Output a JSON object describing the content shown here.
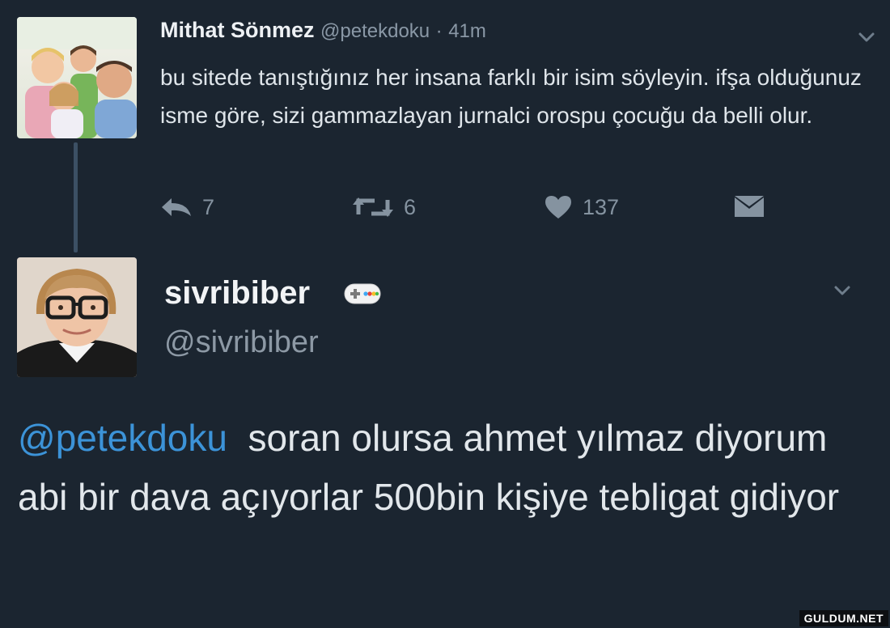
{
  "tweet1": {
    "name": "Mithat Sönmez",
    "handle": "@petekdoku",
    "dot": "·",
    "time": "41m",
    "text": "bu sitede tanıştığınız her insana farklı bir isim söyleyin. ifşa olduğunuz isme göre, sizi gammazlayan jurnalci orospu çocuğu da belli olur.",
    "actions": {
      "reply_icon": "reply-icon",
      "reply_count": "7",
      "retweet_icon": "retweet-icon",
      "retweet_count": "6",
      "like_icon": "heart-icon",
      "like_count": "137",
      "dm_icon": "envelope-icon"
    }
  },
  "tweet2": {
    "name": "sivribiber",
    "badge_icon": "gamepad-icon",
    "handle": "@sivribiber",
    "mention": "@petekdoku",
    "text": "soran olursa ahmet yılmaz diyorum abi bir dava açıyorlar 500bin kişiye tebligat gidiyor"
  },
  "watermark": "GULDUM.NET",
  "colors": {
    "background": "#1b2530",
    "mention": "#3c93d8",
    "muted": "#8a98a6",
    "thread_line": "#3c5064"
  }
}
